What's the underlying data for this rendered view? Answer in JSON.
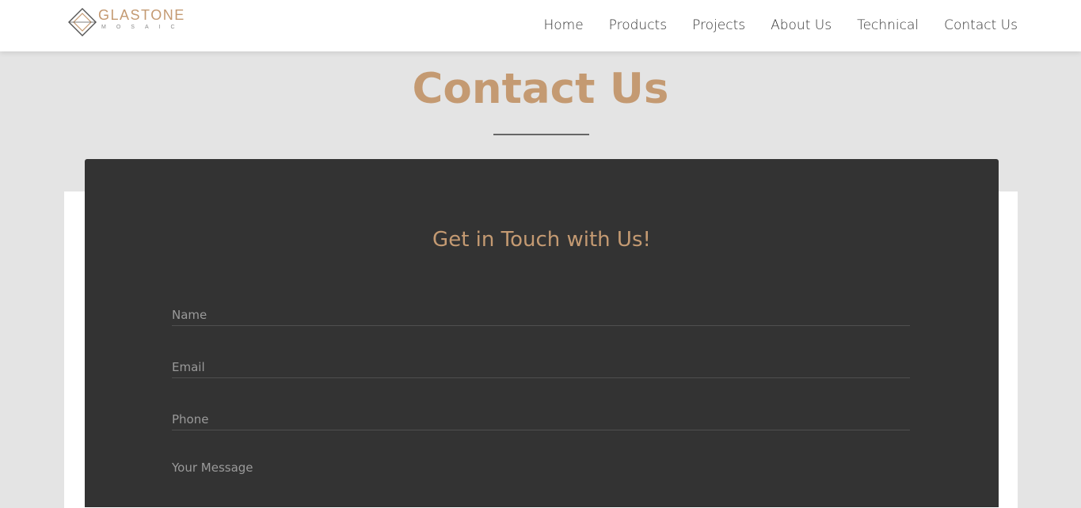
{
  "header": {
    "logo": {
      "name": "GLASTONE",
      "sub": "MOSAIC"
    },
    "nav": [
      "Home",
      "Products",
      "Projects",
      "About Us",
      "Technical",
      "Contact Us"
    ]
  },
  "page": {
    "title": "Contact Us"
  },
  "form": {
    "heading": "Get in Touch with Us!",
    "fields": [
      {
        "placeholder": "Name",
        "value": ""
      },
      {
        "placeholder": "Email",
        "value": ""
      },
      {
        "placeholder": "Phone",
        "value": ""
      },
      {
        "placeholder": "Your Message",
        "value": ""
      }
    ]
  },
  "colors": {
    "accent": "#c49a72",
    "card": "#333333",
    "background": "#e4e4e4"
  }
}
